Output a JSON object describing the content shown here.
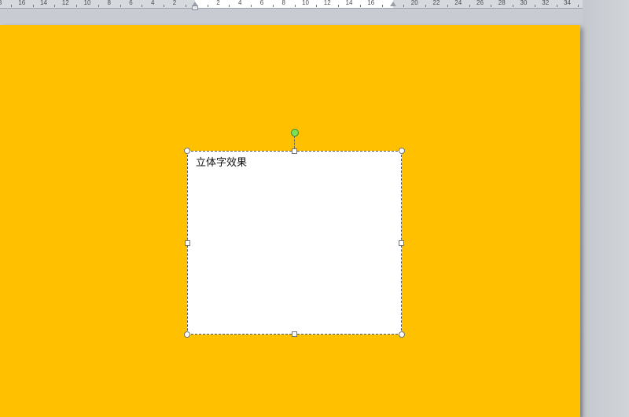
{
  "ruler": {
    "labels": [
      "8",
      "16",
      "14",
      "12",
      "10",
      "8",
      "6",
      "4",
      "2",
      "",
      "2",
      "4",
      "6",
      "8",
      "10",
      "12",
      "14",
      "16",
      "",
      "20",
      "22",
      "24",
      "26",
      "28",
      "30",
      "32",
      "34"
    ]
  },
  "slide": {
    "background_color": "#ffc000"
  },
  "textbox": {
    "text": "立体字效果"
  },
  "selection": {
    "rotate_handle_color": "#7ee05a"
  }
}
